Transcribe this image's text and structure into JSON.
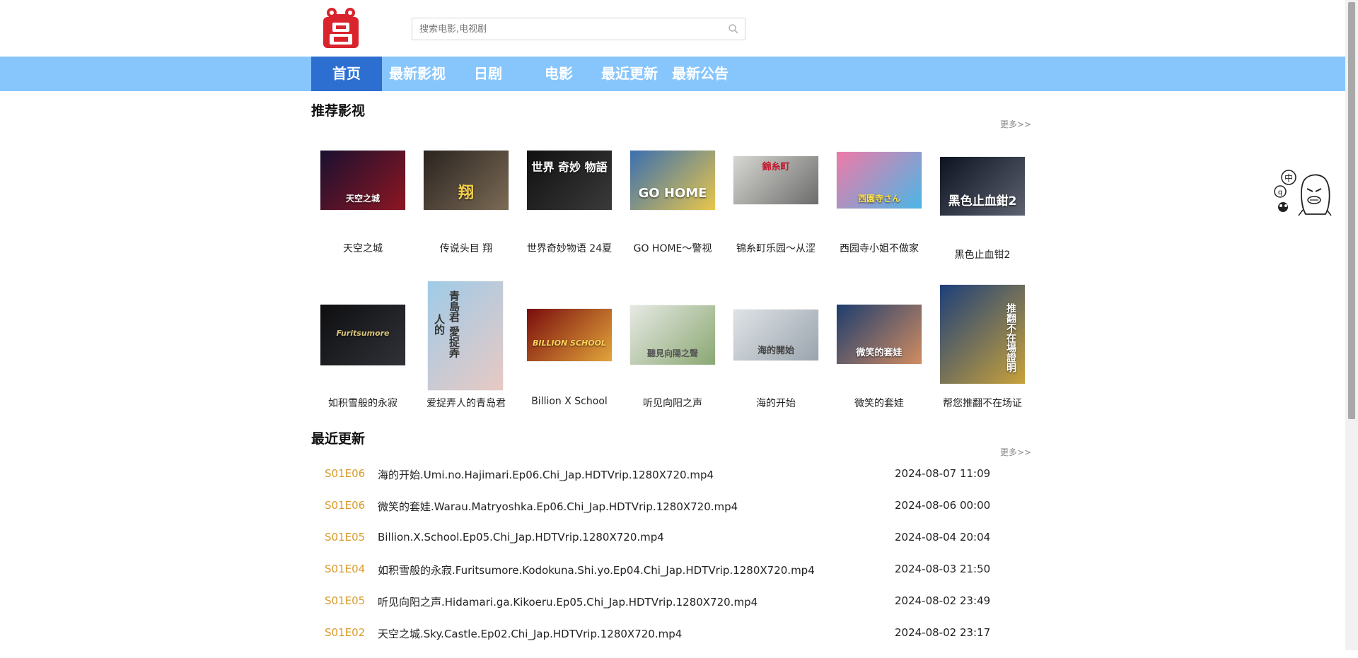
{
  "search": {
    "placeholder": "搜索电影,电视剧"
  },
  "nav": [
    {
      "label": "首页",
      "active": true
    },
    {
      "label": "最新影视",
      "active": false
    },
    {
      "label": "日剧",
      "active": false
    },
    {
      "label": "电影",
      "active": false
    },
    {
      "label": "最近更新",
      "active": false
    },
    {
      "label": "最新公告",
      "active": false
    }
  ],
  "recommended": {
    "title": "推荐影视",
    "more": "更多>>",
    "row1": [
      {
        "title": "天空之城",
        "poster_text": "天空之城",
        "colors": [
          "#1a1030",
          "#8d1622"
        ]
      },
      {
        "title": "传说头目 翔",
        "poster_text": "翔",
        "colors": [
          "#2a2420",
          "#7b6a55"
        ]
      },
      {
        "title": "世界奇妙物语 24夏",
        "poster_text": "世界 奇妙 物語",
        "colors": [
          "#101010",
          "#3a3a3a"
        ]
      },
      {
        "title": "GO HOME～警视",
        "poster_text": "GO HOME",
        "colors": [
          "#3a6fb0",
          "#e8c64a"
        ]
      },
      {
        "title": "锦糸町乐园～从涩",
        "poster_text": "錦糸町",
        "colors": [
          "#d7d7d2",
          "#6c6c6c"
        ]
      },
      {
        "title": "西园寺小姐不做家",
        "poster_text": "西園寺さん",
        "colors": [
          "#f07aa8",
          "#4ab6e6"
        ]
      },
      {
        "title": "黑色止血钳2",
        "poster_text": "黑色止血鉗2",
        "colors": [
          "#0d1320",
          "#5c6270"
        ]
      }
    ],
    "row2": [
      {
        "title": "如积雪般的永寂",
        "poster_text": "Furitsumore",
        "colors": [
          "#0e0e10",
          "#303238"
        ]
      },
      {
        "title": "爱捉弄人的青岛君",
        "poster_text": "青島君 愛捉弄人的",
        "colors": [
          "#9fcbe8",
          "#e8c9c4"
        ]
      },
      {
        "title": "Billion X School",
        "poster_text": "BILLION SCHOOL",
        "colors": [
          "#7a0d0d",
          "#e2a53a"
        ]
      },
      {
        "title": "听见向阳之声",
        "poster_text": "聽見向陽之聲",
        "colors": [
          "#e7e9e4",
          "#8aa872"
        ]
      },
      {
        "title": "海的开始",
        "poster_text": "海的開始",
        "colors": [
          "#dfe3e7",
          "#9aa4ad"
        ]
      },
      {
        "title": "微笑的套娃",
        "poster_text": "微笑的套娃",
        "colors": [
          "#1d3d6e",
          "#d18c61"
        ]
      },
      {
        "title": "帮您推翻不在场证",
        "poster_text": "推翻不在場證明",
        "colors": [
          "#1d3f7a",
          "#c9a23a"
        ]
      }
    ]
  },
  "recent": {
    "title": "最近更新",
    "more": "更多>>",
    "items": [
      {
        "ep": "S01E06",
        "file": "海的开始.Umi.no.Hajimari.Ep06.Chi_Jap.HDTVrip.1280X720.mp4",
        "time": "2024-08-07 11:09"
      },
      {
        "ep": "S01E06",
        "file": "微笑的套娃.Warau.Matryoshka.Ep06.Chi_Jap.HDTVrip.1280X720.mp4",
        "time": "2024-08-06 00:00"
      },
      {
        "ep": "S01E05",
        "file": "Billion.X.School.Ep05.Chi_Jap.HDTVrip.1280X720.mp4",
        "time": "2024-08-04 20:04"
      },
      {
        "ep": "S01E04",
        "file": "如积雪般的永寂.Furitsumore.Kodokuna.Shi.yo.Ep04.Chi_Jap.HDTVrip.1280X720.mp4",
        "time": "2024-08-03 21:50"
      },
      {
        "ep": "S01E05",
        "file": "听见向阳之声.Hidamari.ga.Kikoeru.Ep05.Chi_Jap.HDTVrip.1280X720.mp4",
        "time": "2024-08-02 23:49"
      },
      {
        "ep": "S01E02",
        "file": "天空之城.Sky.Castle.Ep02.Chi_Jap.HDTVrip.1280X720.mp4",
        "time": "2024-08-02 23:17"
      }
    ]
  },
  "widget": {
    "bubble_text": "中"
  },
  "colors": {
    "nav_bg": "#87c6fd",
    "nav_active": "#2d6ed1",
    "episode": "#d89a2a",
    "logo_red": "#d9232d"
  }
}
